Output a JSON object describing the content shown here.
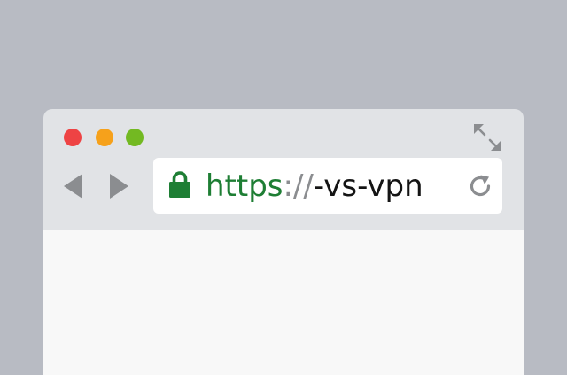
{
  "colors": {
    "background": "#b8bbc3",
    "toolbar": "#e1e3e6",
    "content": "#f8f8f8",
    "address_bar": "#ffffff",
    "close_dot": "#ee4344",
    "minimize_dot": "#f6a11b",
    "maximize_dot": "#73b922",
    "icon_gray": "#8b8d90",
    "secure_green": "#1e7e34",
    "url_text": "#141414"
  },
  "window_controls": {
    "close_icon": "close-dot",
    "minimize_icon": "minimize-dot",
    "maximize_icon": "maximize-dot",
    "expand_icon": "expand-arrows-icon"
  },
  "navigation": {
    "back_icon": "back-arrow-icon",
    "forward_icon": "forward-arrow-icon",
    "reload_icon": "reload-icon"
  },
  "address_bar": {
    "lock_icon": "lock-icon",
    "protocol": "https",
    "separator": "://",
    "host": "-vs-vpn"
  }
}
